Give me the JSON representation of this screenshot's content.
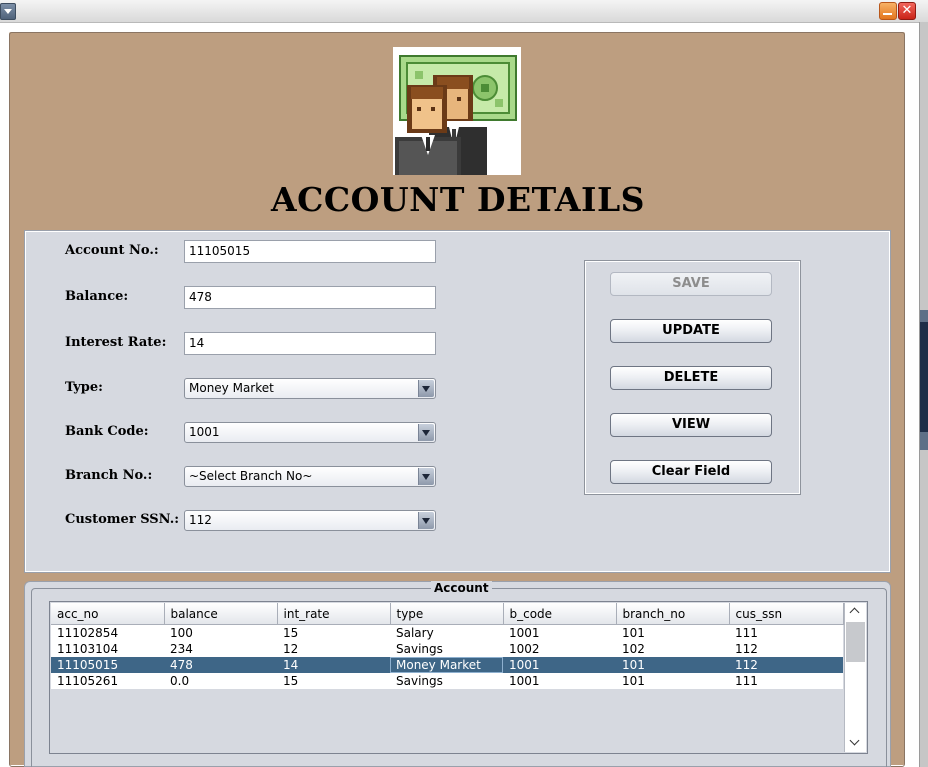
{
  "page_title": "ACCOUNT DETAILS",
  "colors": {
    "frame_bg": "#bd9e80",
    "panel_bg": "#d6d9e0",
    "selected_row": "#3e6687"
  },
  "form": {
    "account_no": {
      "label": "Account No.:",
      "value": "11105015"
    },
    "balance": {
      "label": "Balance:",
      "value": "478"
    },
    "interest_rate": {
      "label": "Interest Rate:",
      "value": "14"
    },
    "type": {
      "label": "Type:",
      "selected": "Money Market"
    },
    "bank_code": {
      "label": "Bank Code:",
      "selected": "1001"
    },
    "branch_no": {
      "label": "Branch No.:",
      "selected": "~Select Branch No~"
    },
    "customer_ssn": {
      "label": "Customer SSN.:",
      "selected": "112"
    }
  },
  "buttons": {
    "save": "SAVE",
    "update": "UPDATE",
    "delete": "DELETE",
    "view": "VIEW",
    "clear": "Clear Field"
  },
  "table": {
    "title": "Account",
    "columns": [
      "acc_no",
      "balance",
      "int_rate",
      "type",
      "b_code",
      "branch_no",
      "cus_ssn"
    ],
    "rows": [
      [
        "11102854",
        "100",
        "15",
        "Salary",
        "1001",
        "101",
        "111"
      ],
      [
        "11103104",
        "234",
        "12",
        "Savings",
        "1002",
        "102",
        "112"
      ],
      [
        "11105015",
        "478",
        "14",
        "Money Market",
        "1001",
        "101",
        "112"
      ],
      [
        "11105261",
        "0.0",
        "15",
        "Savings",
        "1001",
        "101",
        "111"
      ]
    ],
    "selected_row": 2
  }
}
